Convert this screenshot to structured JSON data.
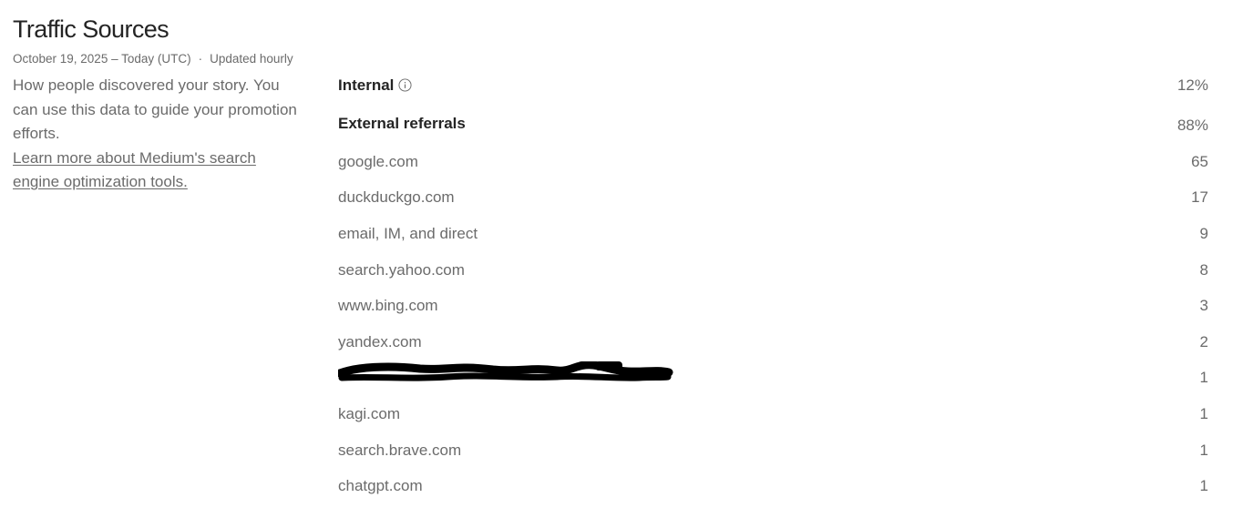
{
  "header": {
    "title": "Traffic Sources",
    "date_range": "October 19, 2025 – Today (UTC)",
    "separator": "·",
    "update_frequency": "Updated hourly"
  },
  "sidebar": {
    "description": "How people discovered your story. You can use this data to guide your promotion efforts.",
    "link_text": "Learn more about Medium's search engine optimization tools."
  },
  "sources": {
    "internal": {
      "label": "Internal",
      "value": "12%"
    },
    "external": {
      "label": "External referrals",
      "value": "88%"
    },
    "referrers": [
      {
        "label": "google.com",
        "value": "65"
      },
      {
        "label": "duckduckgo.com",
        "value": "17"
      },
      {
        "label": "email, IM, and direct",
        "value": "9"
      },
      {
        "label": "search.yahoo.com",
        "value": "8"
      },
      {
        "label": "www.bing.com",
        "value": "3"
      },
      {
        "label": "yandex.com",
        "value": "2"
      },
      {
        "label": "",
        "value": "1"
      },
      {
        "label": "kagi.com",
        "value": "1"
      },
      {
        "label": "search.brave.com",
        "value": "1"
      },
      {
        "label": "chatgpt.com",
        "value": "1"
      }
    ]
  },
  "icons": {
    "info": "info-icon",
    "redaction": "redaction-scribble"
  }
}
